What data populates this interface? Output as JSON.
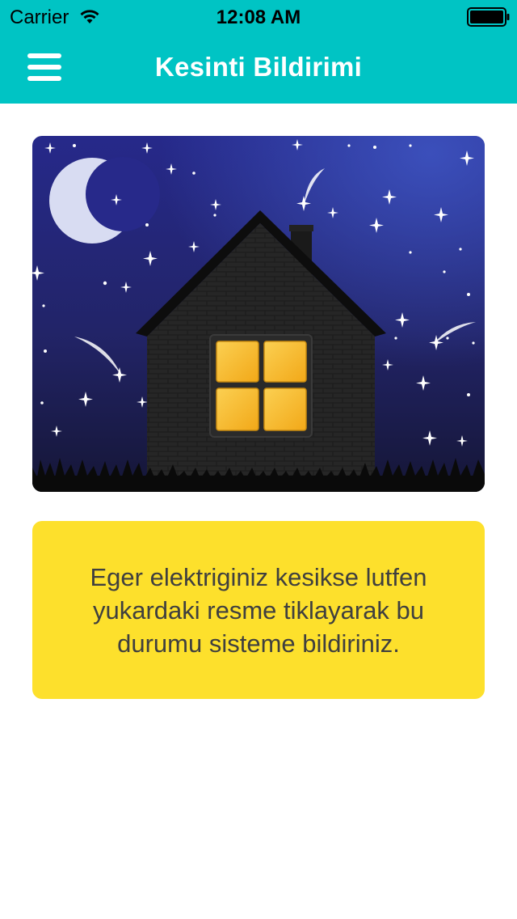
{
  "status_bar": {
    "carrier": "Carrier",
    "time": "12:08 AM",
    "wifi_icon": "wifi-icon",
    "battery_icon": "battery-icon"
  },
  "header": {
    "title": "Kesinti Bildirimi",
    "menu_icon": "hamburger-menu-icon",
    "background_color": "#00c4c4"
  },
  "main": {
    "illustration": {
      "description_icon": "night-house-illustration",
      "window_color": "#f8b920",
      "sky_color": "#24287a"
    },
    "info_box": {
      "text": "Eger elektriginiz kesikse lutfen yukardaki resme tiklayarak bu durumu sisteme bildiriniz.",
      "background_color": "#fde02c"
    }
  }
}
